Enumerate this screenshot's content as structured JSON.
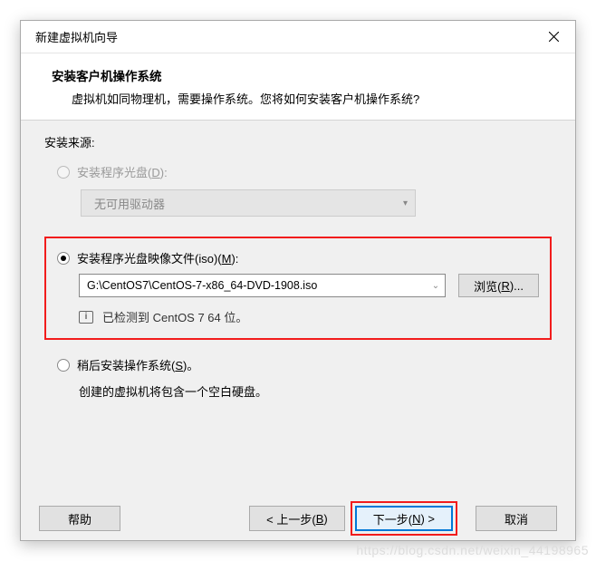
{
  "dialog": {
    "title": "新建虚拟机向导"
  },
  "header": {
    "title": "安装客户机操作系统",
    "desc": "虚拟机如同物理机，需要操作系统。您将如何安装客户机操作系统?"
  },
  "installSource": {
    "label": "安装来源:",
    "option1": {
      "label_pre": "安装程序光盘(",
      "hotkey": "D",
      "label_post": "):",
      "dropdown_text": "无可用驱动器"
    },
    "option2": {
      "label_pre": "安装程序光盘映像文件(iso)(",
      "hotkey": "M",
      "label_post": "):",
      "iso_path": "G:\\CentOS7\\CentOS-7-x86_64-DVD-1908.iso",
      "browse_pre": "浏览(",
      "browse_hotkey": "R",
      "browse_post": ")...",
      "detected": "已检测到 CentOS 7 64 位。"
    },
    "option3": {
      "label_pre": "稍后安装操作系统(",
      "hotkey": "S",
      "label_post": ")。",
      "desc": "创建的虚拟机将包含一个空白硬盘。"
    }
  },
  "footer": {
    "help": "帮助",
    "back_pre": "< 上一步(",
    "back_hotkey": "B",
    "back_post": ")",
    "next_pre": "下一步(",
    "next_hotkey": "N",
    "next_post": ") >",
    "cancel": "取消"
  },
  "watermark": "https://blog.csdn.net/weixin_44198965"
}
